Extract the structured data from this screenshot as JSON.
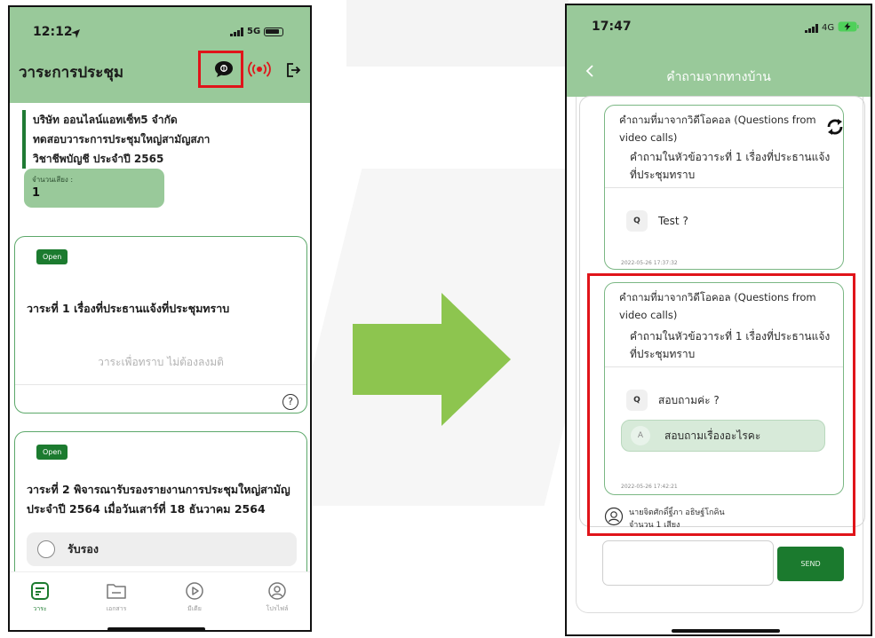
{
  "left_phone": {
    "status": {
      "time": "12:12",
      "network": "5G"
    },
    "header": {
      "title": "วาระการประชุม"
    },
    "company": {
      "line1": "บริษัท ออนไลน์แอทเซ็ท5 จำกัด",
      "line2": "ทดสอบวาระการประชุมใหญ่สามัญสภา",
      "line3": "วิชาชีพบัญชี ประจำปี 2565"
    },
    "votes": {
      "label": "จำนวนเสียง :",
      "value": "1"
    },
    "agenda": [
      {
        "status": "Open",
        "title": "วาระที่ 1 เรื่องที่ประธานแจ้งที่ประชุมทราบ",
        "note": "วาระเพื่อทราบ ไม่ต้องลงมติ"
      },
      {
        "status": "Open",
        "title_line1": "วาระที่ 2 พิจารณารับรองรายงานการประชุมใหญ่สามัญ",
        "title_line2": "ประจำปี 2564 เมื่อวันเสาร์ที่ 18 ธันวาคม 2564",
        "option": "รับรอง"
      }
    ],
    "tabs": [
      {
        "label": "วาระ",
        "icon": "agenda-icon"
      },
      {
        "label": "เอกสาร",
        "icon": "folder-icon"
      },
      {
        "label": "มีเดีย",
        "icon": "play-icon"
      },
      {
        "label": "โปรไฟล์",
        "icon": "profile-icon"
      }
    ]
  },
  "right_phone": {
    "status": {
      "time": "17:47",
      "network": "4G"
    },
    "header": {
      "title": "คำถามจากทางบ้าน"
    },
    "questions": [
      {
        "source_line1": "คำถามที่มาจากวิดีโอคอล (Questions from",
        "source_line2": "video calls)",
        "agenda_line1": "คำถามในหัวข้อวาระที่ 1 เรื่องที่ประธานแจ้ง",
        "agenda_line2": "ที่ประชุมทราบ",
        "q_badge": "Q",
        "question": "Test ?",
        "timestamp": "2022-05-26 17:37:32"
      },
      {
        "source_line1": "คำถามที่มาจากวิดีโอคอล (Questions from",
        "source_line2": "video calls)",
        "agenda_line1": "คำถามในหัวข้อวาระที่ 1 เรื่องที่ประธานแจ้ง",
        "agenda_line2": "ที่ประชุมทราบ",
        "q_badge": "Q",
        "question": "สอบถามค่ะ ?",
        "a_badge": "A",
        "answer": "สอบถามเรื่องอะไรคะ",
        "timestamp": "2022-05-26 17:42:21"
      }
    ],
    "user": {
      "name": "นายจิตศักดิ์ฐิ์ภา อธิษฐ์โกคิน",
      "votes": "จำนวน 1 เสียง"
    },
    "send_label": "SEND"
  },
  "colors": {
    "header_green": "#99c99a",
    "dark_green": "#1c7b2f",
    "highlight_red": "#e0141a",
    "arrow_green": "#8dc54f"
  }
}
